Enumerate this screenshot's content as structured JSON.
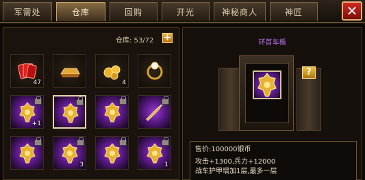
{
  "tabs": [
    {
      "label": "军需处",
      "active": false
    },
    {
      "label": "仓库",
      "active": true
    },
    {
      "label": "回购",
      "active": false
    },
    {
      "label": "开光",
      "active": false
    },
    {
      "label": "神秘商人",
      "active": false
    },
    {
      "label": "神匠",
      "active": false
    }
  ],
  "close_icon": "close-icon",
  "warehouse": {
    "capacity_label": "仓库: 53/72",
    "expand_icon": "plus-icon",
    "items": [
      {
        "icon": "red-card-bundle-icon",
        "quantity": "47",
        "locked": false,
        "selected": false,
        "bg": "dark"
      },
      {
        "icon": "gold-bar-icon",
        "quantity": "",
        "locked": false,
        "selected": false,
        "bg": "dark"
      },
      {
        "icon": "gold-nuggets-icon",
        "quantity": "4",
        "locked": false,
        "selected": false,
        "bg": "dark"
      },
      {
        "icon": "pearl-ring-icon",
        "quantity": "",
        "locked": false,
        "selected": false,
        "bg": "dark"
      },
      {
        "icon": "golden-chariot-ornament-icon",
        "quantity": "+1",
        "locked": true,
        "selected": false,
        "bg": "purple"
      },
      {
        "icon": "golden-chariot-ornament-icon",
        "quantity": "",
        "locked": true,
        "selected": true,
        "bg": "purple"
      },
      {
        "icon": "golden-chariot-ornament-icon",
        "quantity": "",
        "locked": true,
        "selected": false,
        "bg": "purple"
      },
      {
        "icon": "golden-spear-icon",
        "quantity": "",
        "locked": true,
        "selected": false,
        "bg": "purple"
      },
      {
        "icon": "golden-chariot-ornament-icon",
        "quantity": "",
        "locked": true,
        "selected": false,
        "bg": "purple"
      },
      {
        "icon": "golden-chariot-ornament-icon",
        "quantity": "3",
        "locked": true,
        "selected": false,
        "bg": "purple"
      },
      {
        "icon": "golden-chariot-ornament-icon",
        "quantity": "",
        "locked": true,
        "selected": false,
        "bg": "purple"
      },
      {
        "icon": "golden-chariot-ornament-icon",
        "quantity": "1",
        "locked": true,
        "selected": false,
        "bg": "purple"
      }
    ]
  },
  "detail": {
    "item_name": "环首车楯",
    "help_icon": "question-icon",
    "price": "售价:100000银币",
    "stats": "攻击+1300,兵力+12000",
    "effect": "战车护甲增加1层,最多一层"
  },
  "colors": {
    "accent_gold": "#c9a46a",
    "item_name_purple": "#b470e8",
    "close_red": "#d02a22",
    "rarity_purple": "#9a3bd0"
  }
}
